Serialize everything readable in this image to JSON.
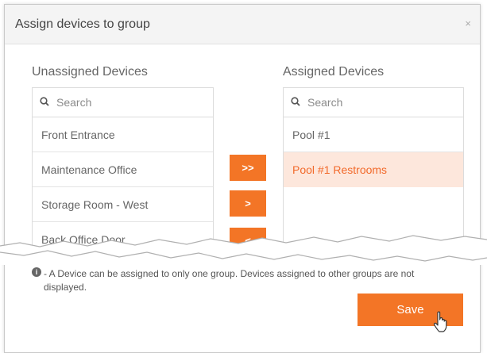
{
  "dialog": {
    "title": "Assign devices to group",
    "close_glyph": "×"
  },
  "unassigned": {
    "label": "Unassigned Devices",
    "search_placeholder": "Search",
    "items": [
      {
        "label": "Front Entrance"
      },
      {
        "label": "Maintenance Office"
      },
      {
        "label": "Storage Room - West"
      },
      {
        "label": "Back Office Door"
      }
    ]
  },
  "assigned": {
    "label": "Assigned Devices",
    "search_placeholder": "Search",
    "items": [
      {
        "label": "Pool #1",
        "selected": false
      },
      {
        "label": "Pool #1 Restrooms",
        "selected": true
      }
    ]
  },
  "move_buttons": {
    "move_all_right": ">>",
    "move_right": ">",
    "move_left": "<"
  },
  "info": {
    "icon": "info-circle-icon",
    "text": "- A Device can be assigned to only one group. Devices assigned to other groups are not displayed."
  },
  "footer": {
    "save_label": "Save"
  },
  "colors": {
    "accent": "#f37526",
    "selected_bg": "#fde7dc",
    "selected_text": "#f26a2b",
    "header_bg": "#f4f4f4"
  }
}
